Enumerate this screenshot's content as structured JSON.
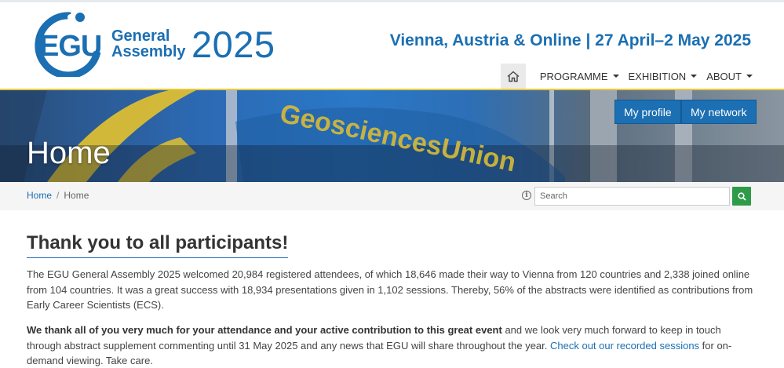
{
  "header": {
    "logo_egu": "EGU",
    "logo_line1": "General",
    "logo_line2": "Assembly",
    "logo_year": "2025",
    "tagline": "Vienna, Austria & Online | 27 April–2 May 2025"
  },
  "nav": {
    "home_icon": "home-icon",
    "items": [
      {
        "label": "PROGRAMME"
      },
      {
        "label": "EXHIBITION"
      },
      {
        "label": "ABOUT"
      }
    ]
  },
  "banner": {
    "title": "Home",
    "flag_text": "GeosciencesUnion",
    "my_profile": "My profile",
    "my_network": "My network"
  },
  "breadcrumb": {
    "home_link": "Home",
    "separator": "/",
    "current": "Home"
  },
  "search": {
    "placeholder": "Search",
    "info_icon": "info-icon",
    "button_icon": "search-icon"
  },
  "main": {
    "heading": "Thank you to all participants!",
    "para1": "The EGU General Assembly 2025 welcomed 20,984 registered attendees, of which 18,646 made their way to Vienna from 120 countries and 2,338 joined online from 104 countries. It was a great success with 18,934 presentations given in 1,102 sessions. Thereby, 56% of the abstracts were identified as contributions from Early Career Scientists (ECS).",
    "para2_bold": "We thank all of you very much for your attendance and your active contribution to this great event",
    "para2_text": " and we look very much forward to keep in touch through abstract supplement commenting until 31 May 2025 and any news that EGU will share throughout the year. ",
    "para2_link": "Check out our recorded sessions",
    "para2_end": " for on-demand viewing. Take care."
  },
  "colors": {
    "brand_blue": "#1b6fb2",
    "accent_gold": "#e9c83a",
    "search_green": "#2e9b48"
  }
}
